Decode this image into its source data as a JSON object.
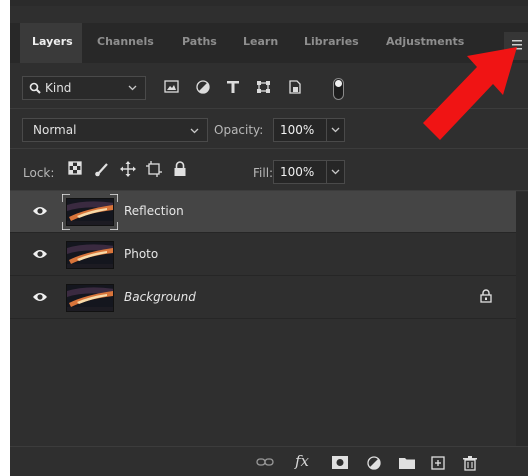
{
  "tabs": [
    {
      "label": "Layers",
      "active": true
    },
    {
      "label": "Channels"
    },
    {
      "label": "Paths"
    },
    {
      "label": "Learn"
    },
    {
      "label": "Libraries"
    },
    {
      "label": "Adjustments"
    }
  ],
  "filter": {
    "kind_label": "Kind",
    "icons": [
      "pixel-filter-icon",
      "adjustment-filter-icon",
      "type-filter-icon",
      "shape-filter-icon",
      "smart-object-filter-icon"
    ],
    "toggle_on": true
  },
  "blend": {
    "mode": "Normal",
    "opacity_label": "Opacity:",
    "opacity_value": "100%"
  },
  "lock": {
    "label": "Lock:",
    "icons": [
      "lock-transparent-pixels-icon",
      "lock-image-pixels-icon",
      "lock-position-icon",
      "lock-artboard-icon",
      "lock-all-icon"
    ],
    "fill_label": "Fill:",
    "fill_value": "100%"
  },
  "layers": [
    {
      "name": "Reflection",
      "selected": true,
      "visible": true,
      "locked": false,
      "italic": false
    },
    {
      "name": "Photo",
      "selected": false,
      "visible": true,
      "locked": false,
      "italic": false
    },
    {
      "name": "Background",
      "selected": false,
      "visible": true,
      "locked": true,
      "italic": true
    }
  ],
  "footer": {
    "fx_label": "fx",
    "icons": [
      "link-layers-icon",
      "fx-icon",
      "add-mask-icon",
      "new-adjustment-layer-icon",
      "new-group-icon",
      "new-layer-icon",
      "delete-layer-icon"
    ]
  },
  "colors": {
    "panel_bg": "#2f2f2f",
    "selected_row": "#454545",
    "annotation_arrow": "#f01414"
  }
}
